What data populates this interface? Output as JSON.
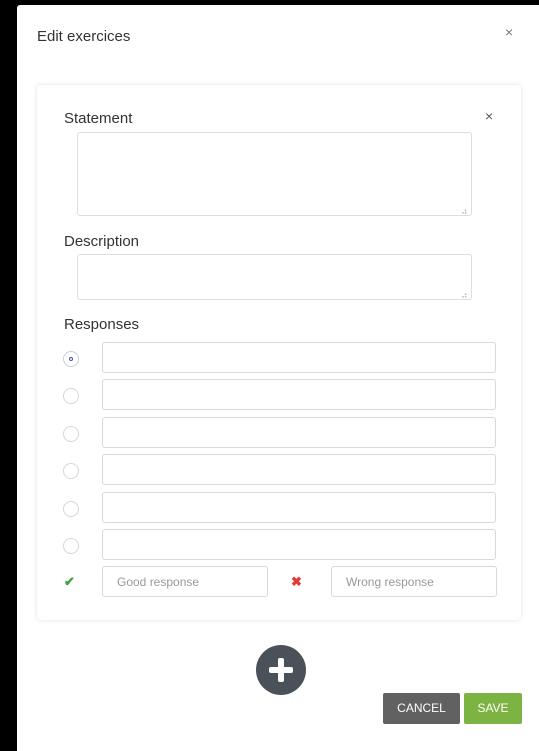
{
  "modal": {
    "title": "Edit exercices",
    "close_glyph": "×"
  },
  "card": {
    "close_glyph": "×",
    "statement_label": "Statement",
    "description_label": "Description",
    "responses_label": "Responses",
    "statement_value": "",
    "description_value": "",
    "resize_grip": "⠴"
  },
  "responses": [
    {
      "value": "",
      "selected": true
    },
    {
      "value": "",
      "selected": false
    },
    {
      "value": "",
      "selected": false
    },
    {
      "value": "",
      "selected": false
    },
    {
      "value": "",
      "selected": false
    },
    {
      "value": "",
      "selected": false
    }
  ],
  "feedback": {
    "good_icon": "✔",
    "good_placeholder": "Good response",
    "wrong_icon": "✖",
    "wrong_placeholder": "Wrong response",
    "good_color": "#43a047",
    "wrong_color": "#e53935"
  },
  "footer": {
    "cancel_label": "CANCEL",
    "save_label": "SAVE",
    "add_icon": "plus-icon"
  },
  "colors": {
    "save": "#7cb342",
    "cancel": "#616161",
    "add": "#4a5158",
    "radio_selected": "#3f51b5"
  }
}
